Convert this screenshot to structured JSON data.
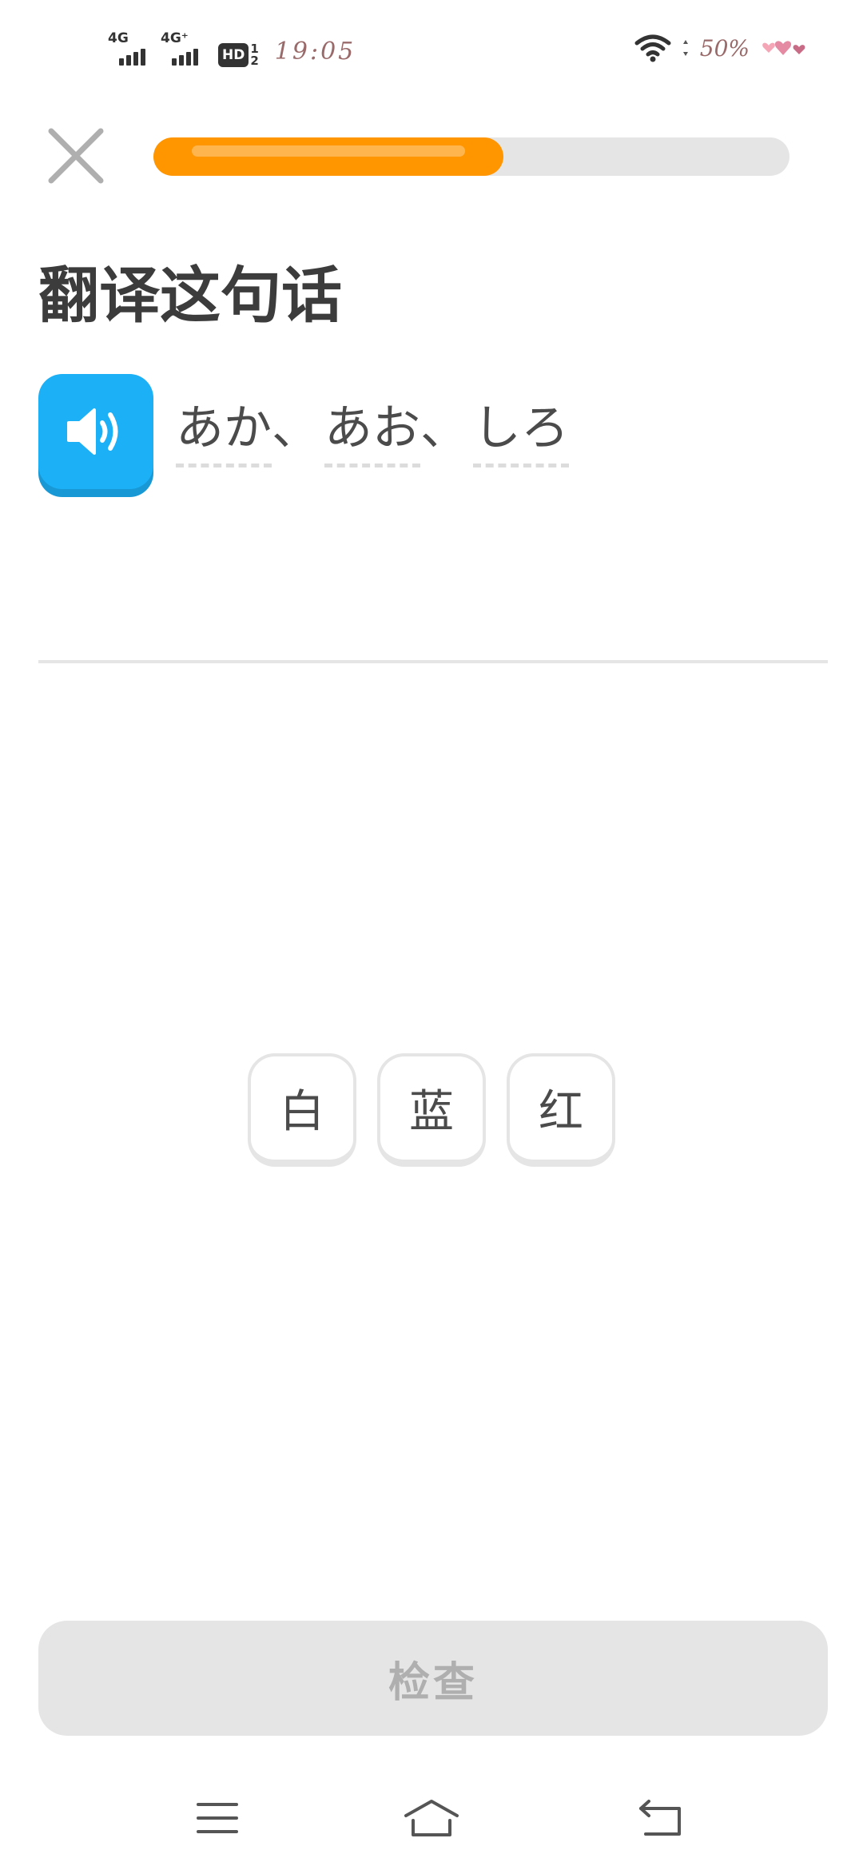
{
  "status_bar": {
    "sim1_network": "4G",
    "sim2_network": "4G⁺",
    "hd_label": "HD",
    "hd_sim_top": "1",
    "hd_sim_bottom": "2",
    "time": "19:05",
    "battery": "50%",
    "icons": [
      "signal-icon",
      "signal-icon",
      "hd-volte-icon",
      "wifi-icon",
      "hearts-sticker-icon"
    ]
  },
  "top_bar": {
    "close_icon": "close-icon",
    "progress_fraction": 0.55
  },
  "prompt": {
    "title": "翻译这句话",
    "speaker_icon": "speaker-icon",
    "sentence_words": [
      "あか",
      "あお",
      "しろ"
    ],
    "separator": "、"
  },
  "word_bank": {
    "tiles": [
      "白",
      "蓝",
      "红"
    ]
  },
  "check_button": {
    "label": "检查",
    "enabled": false
  },
  "nav_bar": {
    "icons": [
      "menu-icon",
      "home-icon",
      "back-icon"
    ]
  },
  "colors": {
    "progress": "#ff9600",
    "speaker": "#1cb0f6",
    "disabled_button": "#e5e5e5",
    "tile_border": "#e5e5e5"
  }
}
